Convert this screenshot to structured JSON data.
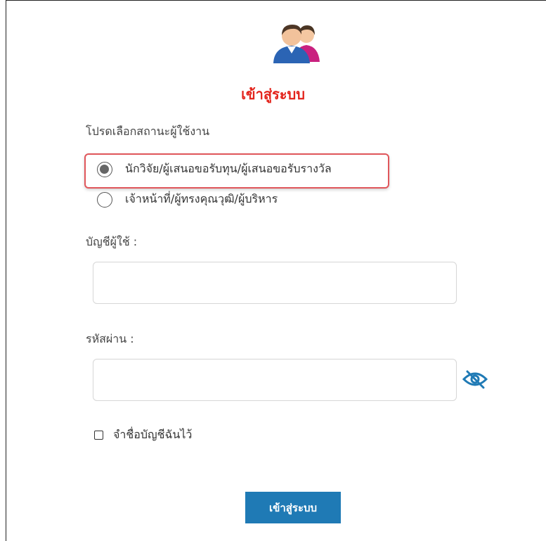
{
  "login": {
    "title": "เข้าสู่ระบบ",
    "status_prompt": "โปรดเลือกสถานะผู้ใช้งาน",
    "roles": [
      {
        "label": "นักวิจัย/ผู้เสนอขอรับทุน/ผู้เสนอขอรับรางวัล",
        "checked": true
      },
      {
        "label": "เจ้าหน้าที่/ผู้ทรงคุณวุฒิ/ผู้บริหาร",
        "checked": false
      }
    ],
    "username_label": "บัญชีผู้ใช้ :",
    "username_value": "",
    "password_label": "รหัสผ่าน :",
    "password_value": "",
    "remember_label": "จำชื่อบัญชีฉันไว้",
    "remember_checked": false,
    "submit_label": "เข้าสู่ระบบ"
  },
  "colors": {
    "title_red": "#e3231b",
    "button_blue": "#1f7ab5",
    "eye_icon": "#1f7ab5",
    "highlight": "#e0565b"
  },
  "icons": {
    "header": "users-avatar-icon",
    "password_toggle": "eye-slash-icon"
  }
}
